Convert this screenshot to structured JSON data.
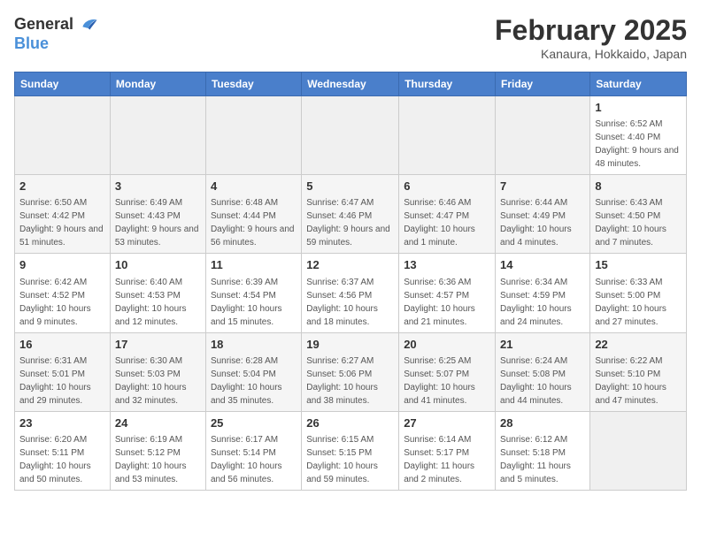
{
  "logo": {
    "general": "General",
    "blue": "Blue"
  },
  "header": {
    "month": "February 2025",
    "location": "Kanaura, Hokkaido, Japan"
  },
  "weekdays": [
    "Sunday",
    "Monday",
    "Tuesday",
    "Wednesday",
    "Thursday",
    "Friday",
    "Saturday"
  ],
  "weeks": [
    [
      {
        "day": "",
        "info": ""
      },
      {
        "day": "",
        "info": ""
      },
      {
        "day": "",
        "info": ""
      },
      {
        "day": "",
        "info": ""
      },
      {
        "day": "",
        "info": ""
      },
      {
        "day": "",
        "info": ""
      },
      {
        "day": "1",
        "info": "Sunrise: 6:52 AM\nSunset: 4:40 PM\nDaylight: 9 hours and 48 minutes."
      }
    ],
    [
      {
        "day": "2",
        "info": "Sunrise: 6:50 AM\nSunset: 4:42 PM\nDaylight: 9 hours and 51 minutes."
      },
      {
        "day": "3",
        "info": "Sunrise: 6:49 AM\nSunset: 4:43 PM\nDaylight: 9 hours and 53 minutes."
      },
      {
        "day": "4",
        "info": "Sunrise: 6:48 AM\nSunset: 4:44 PM\nDaylight: 9 hours and 56 minutes."
      },
      {
        "day": "5",
        "info": "Sunrise: 6:47 AM\nSunset: 4:46 PM\nDaylight: 9 hours and 59 minutes."
      },
      {
        "day": "6",
        "info": "Sunrise: 6:46 AM\nSunset: 4:47 PM\nDaylight: 10 hours and 1 minute."
      },
      {
        "day": "7",
        "info": "Sunrise: 6:44 AM\nSunset: 4:49 PM\nDaylight: 10 hours and 4 minutes."
      },
      {
        "day": "8",
        "info": "Sunrise: 6:43 AM\nSunset: 4:50 PM\nDaylight: 10 hours and 7 minutes."
      }
    ],
    [
      {
        "day": "9",
        "info": "Sunrise: 6:42 AM\nSunset: 4:52 PM\nDaylight: 10 hours and 9 minutes."
      },
      {
        "day": "10",
        "info": "Sunrise: 6:40 AM\nSunset: 4:53 PM\nDaylight: 10 hours and 12 minutes."
      },
      {
        "day": "11",
        "info": "Sunrise: 6:39 AM\nSunset: 4:54 PM\nDaylight: 10 hours and 15 minutes."
      },
      {
        "day": "12",
        "info": "Sunrise: 6:37 AM\nSunset: 4:56 PM\nDaylight: 10 hours and 18 minutes."
      },
      {
        "day": "13",
        "info": "Sunrise: 6:36 AM\nSunset: 4:57 PM\nDaylight: 10 hours and 21 minutes."
      },
      {
        "day": "14",
        "info": "Sunrise: 6:34 AM\nSunset: 4:59 PM\nDaylight: 10 hours and 24 minutes."
      },
      {
        "day": "15",
        "info": "Sunrise: 6:33 AM\nSunset: 5:00 PM\nDaylight: 10 hours and 27 minutes."
      }
    ],
    [
      {
        "day": "16",
        "info": "Sunrise: 6:31 AM\nSunset: 5:01 PM\nDaylight: 10 hours and 29 minutes."
      },
      {
        "day": "17",
        "info": "Sunrise: 6:30 AM\nSunset: 5:03 PM\nDaylight: 10 hours and 32 minutes."
      },
      {
        "day": "18",
        "info": "Sunrise: 6:28 AM\nSunset: 5:04 PM\nDaylight: 10 hours and 35 minutes."
      },
      {
        "day": "19",
        "info": "Sunrise: 6:27 AM\nSunset: 5:06 PM\nDaylight: 10 hours and 38 minutes."
      },
      {
        "day": "20",
        "info": "Sunrise: 6:25 AM\nSunset: 5:07 PM\nDaylight: 10 hours and 41 minutes."
      },
      {
        "day": "21",
        "info": "Sunrise: 6:24 AM\nSunset: 5:08 PM\nDaylight: 10 hours and 44 minutes."
      },
      {
        "day": "22",
        "info": "Sunrise: 6:22 AM\nSunset: 5:10 PM\nDaylight: 10 hours and 47 minutes."
      }
    ],
    [
      {
        "day": "23",
        "info": "Sunrise: 6:20 AM\nSunset: 5:11 PM\nDaylight: 10 hours and 50 minutes."
      },
      {
        "day": "24",
        "info": "Sunrise: 6:19 AM\nSunset: 5:12 PM\nDaylight: 10 hours and 53 minutes."
      },
      {
        "day": "25",
        "info": "Sunrise: 6:17 AM\nSunset: 5:14 PM\nDaylight: 10 hours and 56 minutes."
      },
      {
        "day": "26",
        "info": "Sunrise: 6:15 AM\nSunset: 5:15 PM\nDaylight: 10 hours and 59 minutes."
      },
      {
        "day": "27",
        "info": "Sunrise: 6:14 AM\nSunset: 5:17 PM\nDaylight: 11 hours and 2 minutes."
      },
      {
        "day": "28",
        "info": "Sunrise: 6:12 AM\nSunset: 5:18 PM\nDaylight: 11 hours and 5 minutes."
      },
      {
        "day": "",
        "info": ""
      }
    ]
  ]
}
